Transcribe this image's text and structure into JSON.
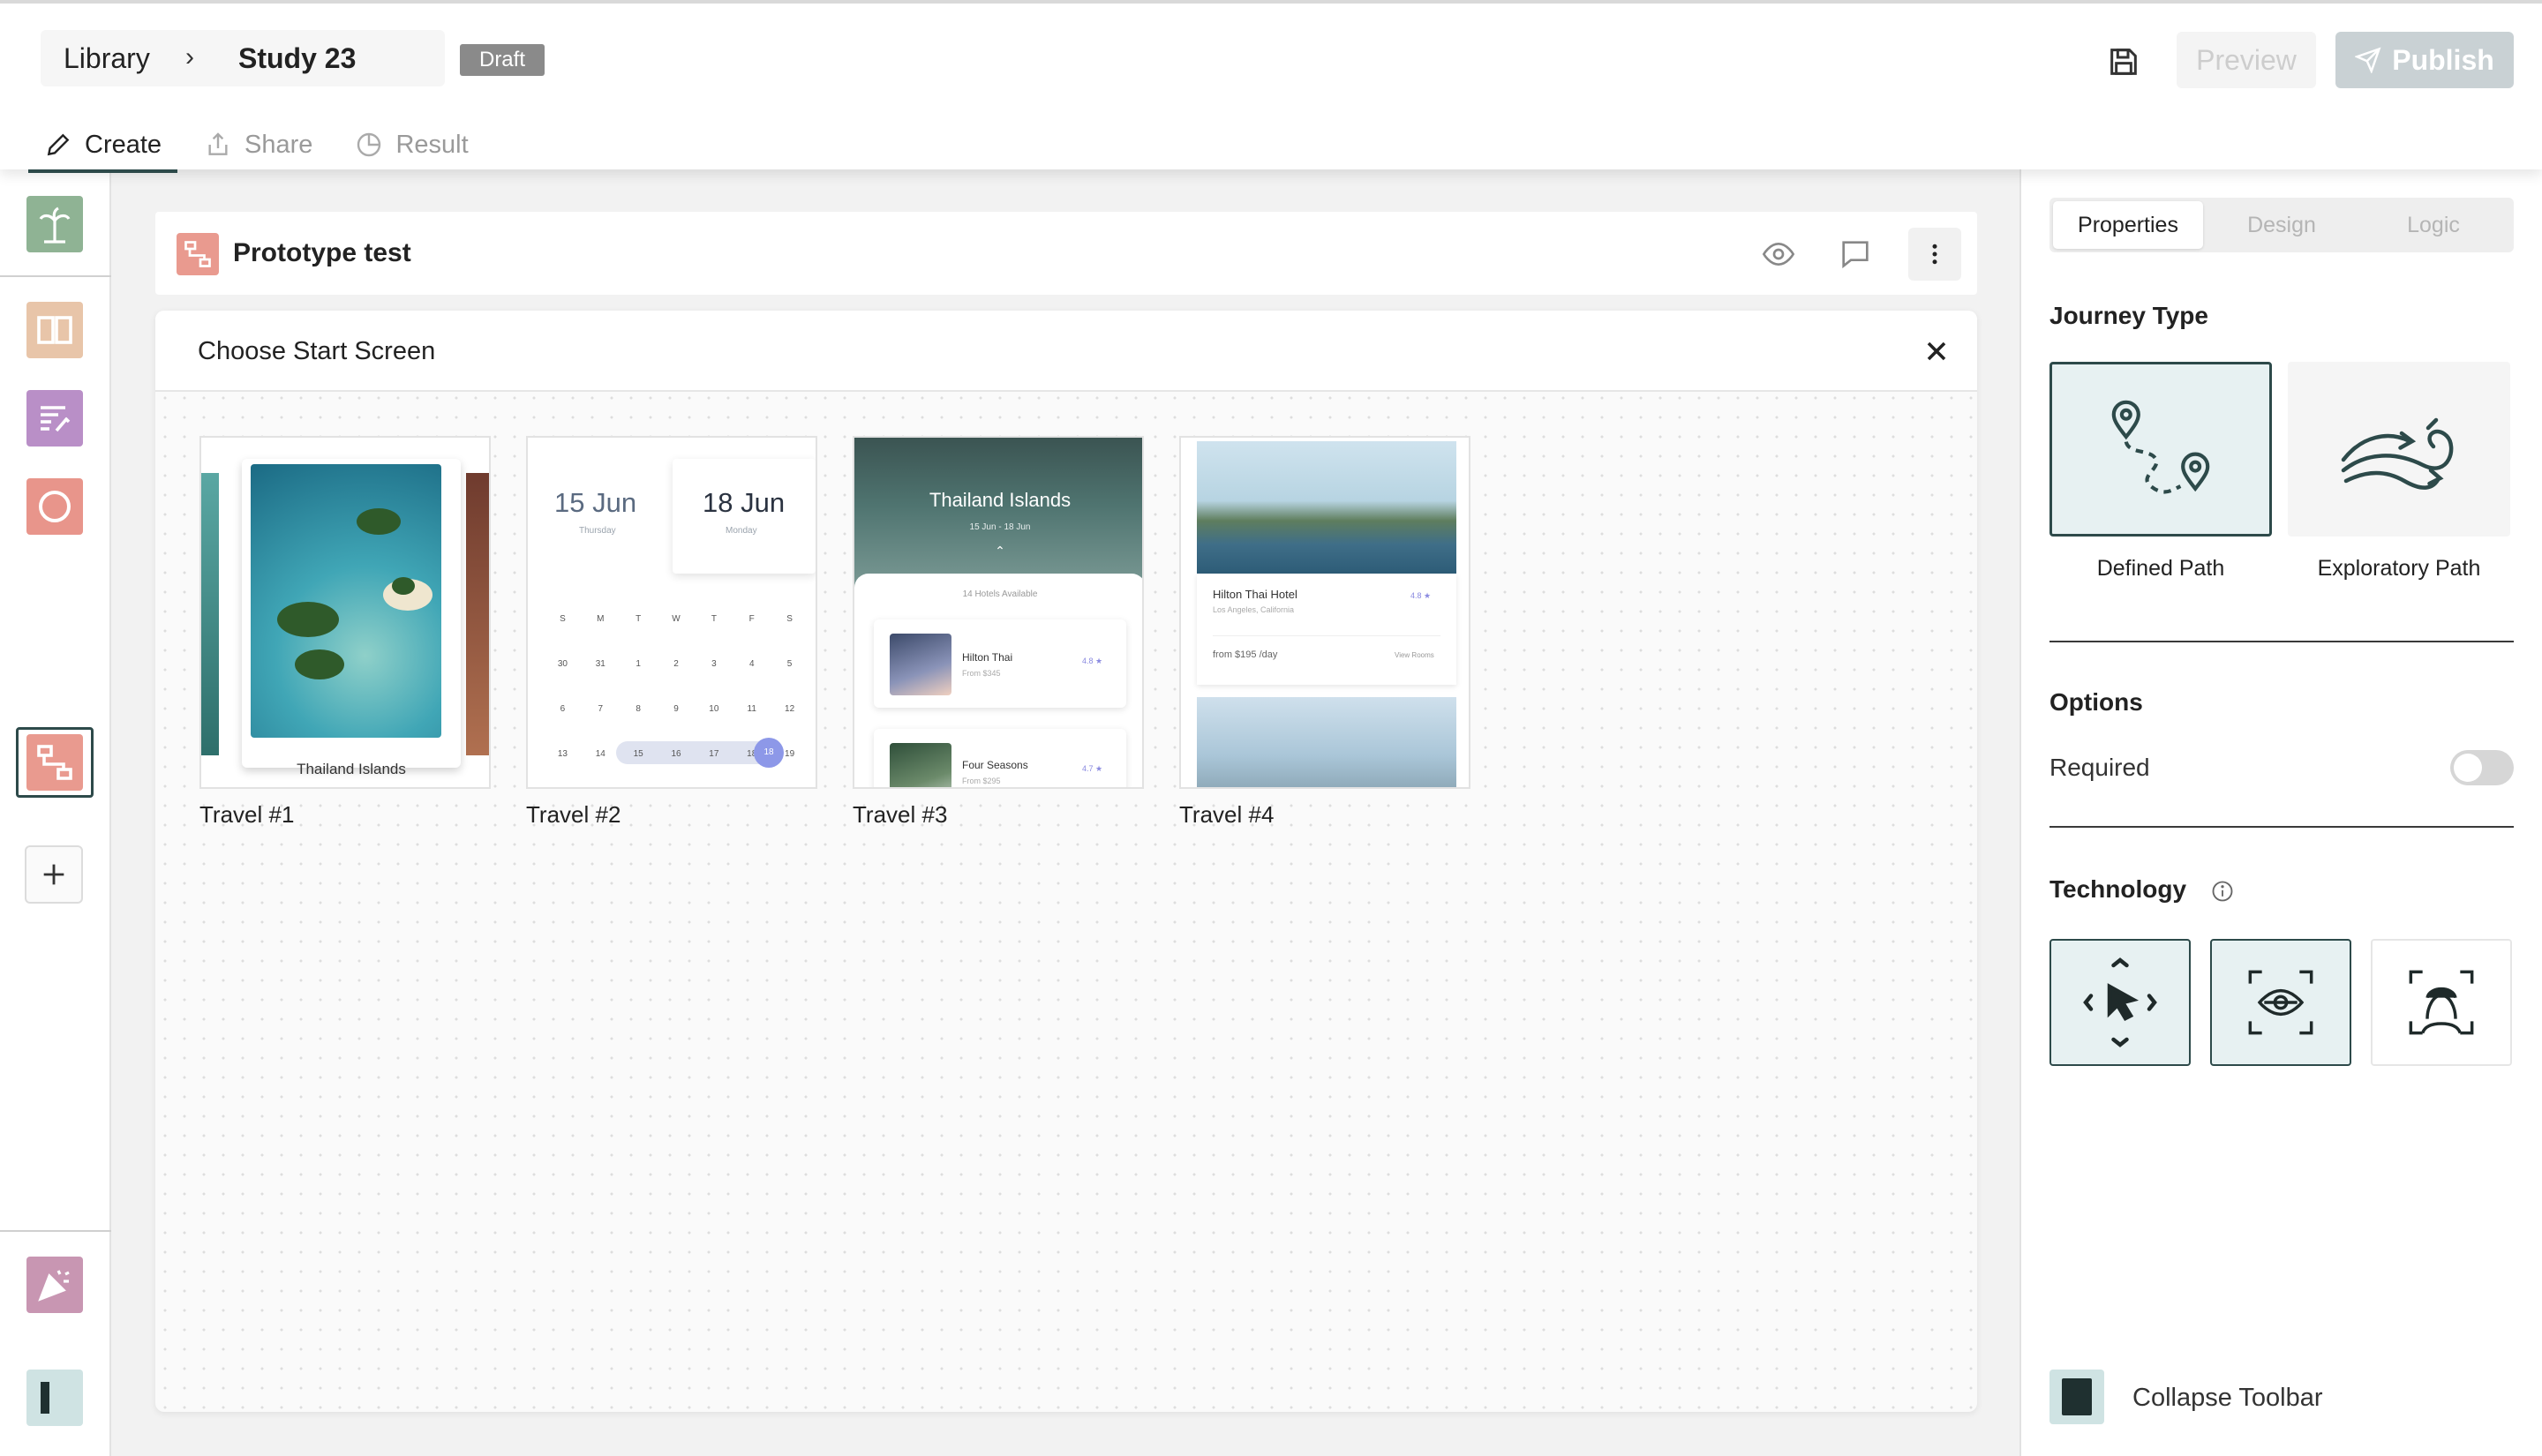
{
  "breadcrumb": {
    "library": "Library",
    "separator": "›",
    "study": "Study 23"
  },
  "status_badge": "Draft",
  "actions": {
    "preview": "Preview",
    "publish": "Publish"
  },
  "tabs": [
    {
      "label": "Create",
      "icon": "pencil-icon",
      "active": true
    },
    {
      "label": "Share",
      "icon": "share-icon",
      "active": false
    },
    {
      "label": "Result",
      "icon": "pie-chart-icon",
      "active": false
    }
  ],
  "left_toolbar": {
    "items": [
      {
        "name": "welcome-block",
        "color": "#8fb394",
        "icon": "palm-tree-icon"
      },
      {
        "name": "split-block",
        "color": "#e8c5a9",
        "icon": "split-screen-icon"
      },
      {
        "name": "text-block",
        "color": "#b98fc7",
        "icon": "text-lines-icon"
      },
      {
        "name": "circle-block",
        "color": "#e8958b",
        "icon": "circle-icon"
      },
      {
        "name": "prototype-block",
        "color": "#e99a8f",
        "icon": "flow-icon",
        "selected": true
      }
    ],
    "bottom_items": [
      {
        "name": "finish-block",
        "color": "#c896b2",
        "icon": "party-popper-icon"
      },
      {
        "name": "layout-block",
        "color": "#cfe3e3",
        "icon": "sidebar-icon"
      }
    ]
  },
  "block": {
    "title": "Prototype test",
    "icon": "flow-icon"
  },
  "start_screen": {
    "title": "Choose Start Screen",
    "screens": [
      {
        "label": "Travel #1",
        "caption": "Thailand Islands"
      },
      {
        "label": "Travel #2",
        "date_from": "15 Jun",
        "day_from": "Thursday",
        "date_to": "18 Jun",
        "day_to": "Monday",
        "weekdays": [
          "S",
          "M",
          "T",
          "W",
          "T",
          "F",
          "S"
        ],
        "weeks": [
          [
            "30",
            "31",
            "1",
            "2",
            "3",
            "4",
            "5"
          ],
          [
            "6",
            "7",
            "8",
            "9",
            "10",
            "11",
            "12"
          ],
          [
            "13",
            "14",
            "15",
            "16",
            "17",
            "18",
            "19"
          ]
        ]
      },
      {
        "label": "Travel #3",
        "title": "Thailand Islands",
        "dates": "15 Jun - 18 Jun",
        "available": "14 Hotels Available",
        "hotels": [
          {
            "name": "Hilton Thai",
            "price": "From $345",
            "rating": "4.8 ★"
          },
          {
            "name": "Four Seasons",
            "price": "From $295",
            "rating": "4.7 ★"
          }
        ]
      },
      {
        "label": "Travel #4",
        "hotel": "Hilton Thai Hotel",
        "location": "Los Angeles, California",
        "rating": "4.8 ★",
        "price": "from $195 /day",
        "view": "View Rooms"
      }
    ]
  },
  "properties": {
    "tabs": [
      "Properties",
      "Design",
      "Logic"
    ],
    "journey_type": {
      "title": "Journey Type",
      "options": [
        {
          "label": "Defined Path",
          "icon": "defined-path-icon",
          "selected": true
        },
        {
          "label": "Exploratory Path",
          "icon": "exploratory-path-icon",
          "selected": false
        }
      ]
    },
    "options": {
      "title": "Options",
      "required_label": "Required",
      "required": false
    },
    "technology": {
      "title": "Technology",
      "items": [
        {
          "icon": "cursor-move-icon",
          "selected": true
        },
        {
          "icon": "eye-tracking-icon",
          "selected": true
        },
        {
          "icon": "face-scan-icon",
          "selected": false
        }
      ]
    },
    "collapse_label": "Collapse Toolbar"
  },
  "colors": {
    "accent": "#2d4a4a",
    "selected_fill": "#e7f1f2",
    "publish_disabled": "#c9d1d4"
  }
}
